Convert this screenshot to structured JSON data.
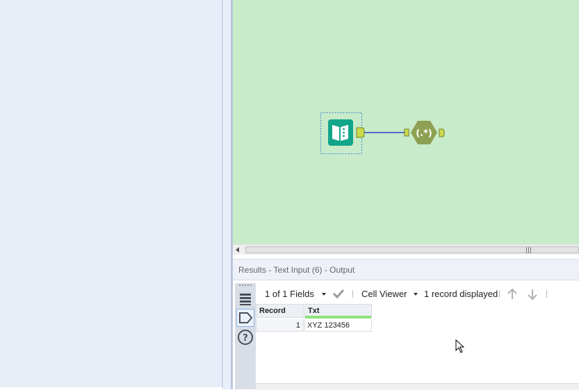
{
  "results": {
    "title": "Results - Text Input (6) - Output",
    "fields_selector": "1 of 1 Fields",
    "viewer_selector": "Cell Viewer",
    "record_count": "1 record displayed",
    "columns": [
      "Record",
      "Txt"
    ],
    "rows": [
      {
        "record": "1",
        "txt": "XYZ 123456"
      }
    ]
  },
  "canvas": {
    "background": "#c8ebc9",
    "tool1": {
      "icon": "text-input-book-icon",
      "color": "#12a58a"
    },
    "tool2": {
      "icon": "regex-hexagon-icon",
      "label": "(.*)",
      "color": "#8ea153"
    },
    "connection_color": "#2f3fd2"
  },
  "toolbar_icons": [
    "table-view-icon",
    "tag-icon",
    "help-icon"
  ],
  "action_icons": [
    "apply-check-icon",
    "arrow-up-icon",
    "arrow-down-icon"
  ]
}
